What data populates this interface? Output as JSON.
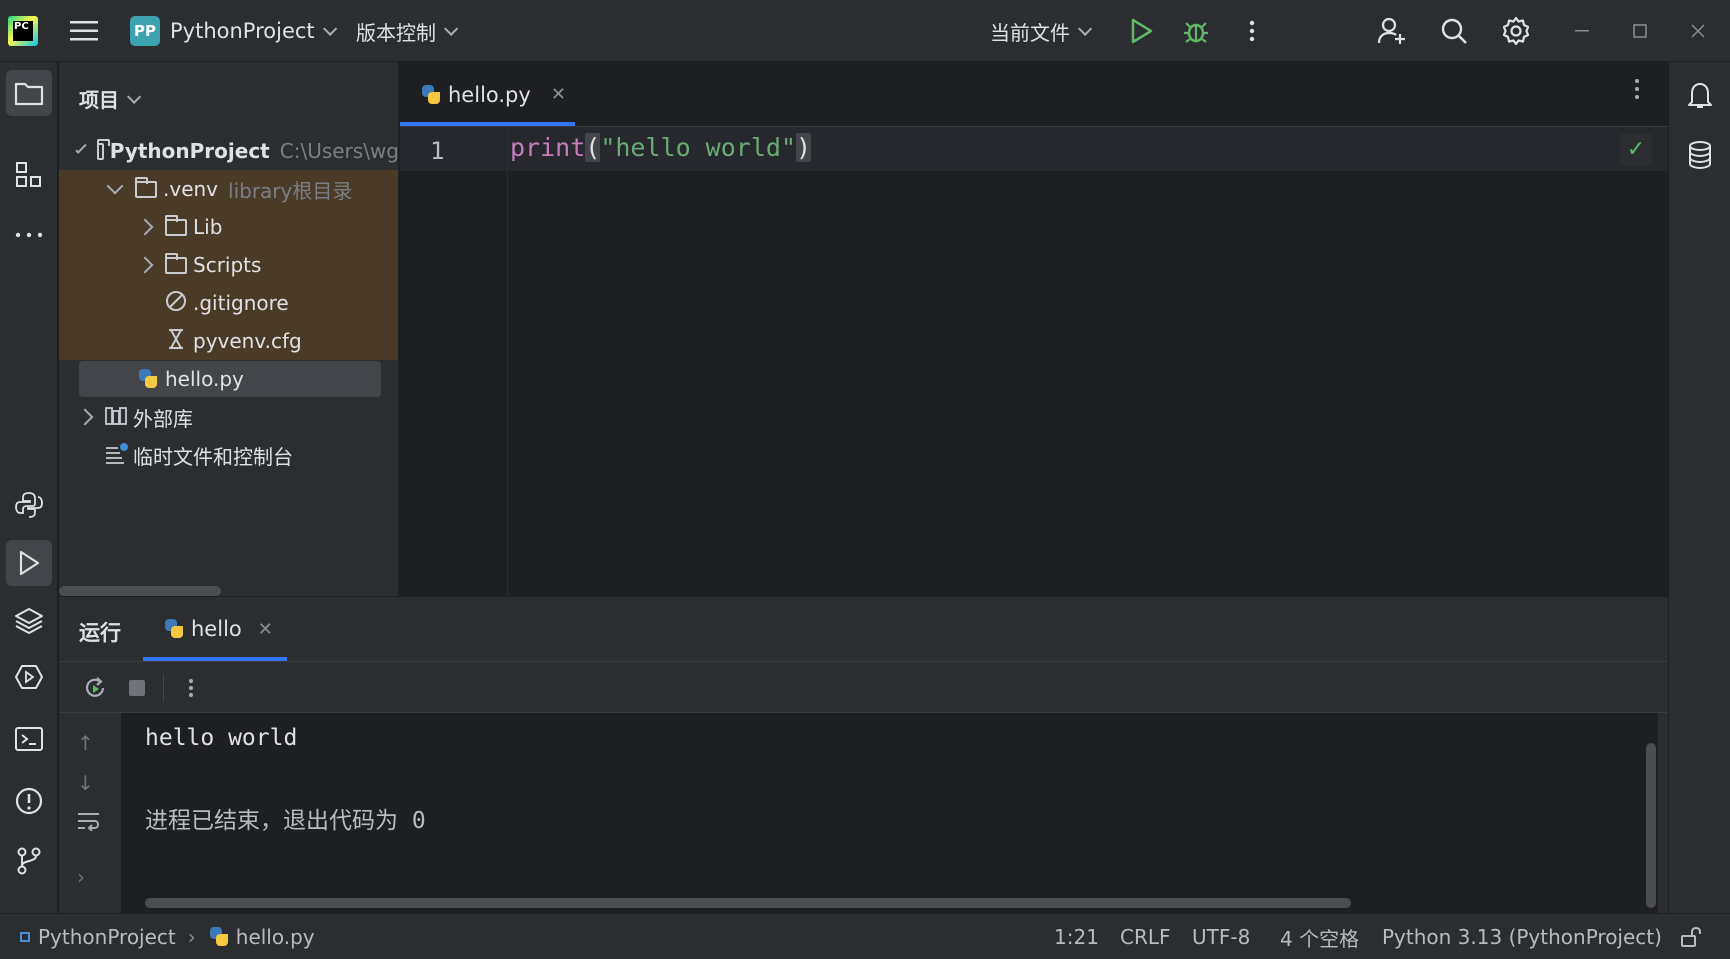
{
  "titlebar": {
    "project_badge": "PP",
    "project_name": "PythonProject",
    "vcs_label": "版本控制",
    "run_config": "当前文件",
    "icons": {
      "logo": "pycharm-logo-icon",
      "menu": "hamburger-menu-icon",
      "run": "run-icon",
      "debug": "debug-icon",
      "more": "more-vertical-icon",
      "collab": "add-user-icon",
      "search": "search-icon",
      "settings": "gear-icon",
      "minimize": "minimize-icon",
      "maximize": "maximize-icon",
      "close": "close-icon"
    }
  },
  "project_panel": {
    "title": "项目",
    "tree": [
      {
        "label": "PythonProject",
        "hint": "C:\\Users\\wg",
        "level": 0,
        "expanded": true,
        "kind": "folder"
      },
      {
        "label": ".venv",
        "hint": "library根目录",
        "level": 1,
        "expanded": true,
        "kind": "folder"
      },
      {
        "label": "Lib",
        "level": 2,
        "expanded": false,
        "kind": "folder"
      },
      {
        "label": "Scripts",
        "level": 2,
        "expanded": false,
        "kind": "folder"
      },
      {
        "label": ".gitignore",
        "level": 2,
        "kind": "ignore-file"
      },
      {
        "label": "pyvenv.cfg",
        "level": 2,
        "kind": "config-file"
      },
      {
        "label": "hello.py",
        "level": 1,
        "kind": "python-file",
        "selected": true
      },
      {
        "label": "外部库",
        "level": 0,
        "expanded": false,
        "kind": "library"
      },
      {
        "label": "临时文件和控制台",
        "level": 0,
        "kind": "scratches"
      }
    ]
  },
  "editor": {
    "tab_label": "hello.py",
    "line_number": "1",
    "code": {
      "fn": "print",
      "open": "(",
      "str": "\"hello world\"",
      "close": ")"
    },
    "inspection": "✓"
  },
  "run_panel": {
    "title": "运行",
    "tab_label": "hello",
    "output": [
      "hello world",
      "进程已结束，退出代码为 0"
    ]
  },
  "statusbar": {
    "breadcrumb_project": "PythonProject",
    "breadcrumb_file": "hello.py",
    "position": "1:21",
    "line_sep": "CRLF",
    "encoding": "UTF-8",
    "indent": "4 个空格",
    "interpreter": "Python 3.13 (PythonProject)"
  },
  "colors": {
    "accent": "#3574f0",
    "background": "#1e1f22",
    "panel": "#2b2d30",
    "excluded_bg": "#4a3a28",
    "run_green": "#5fb865",
    "string": "#6aab73",
    "function": "#c77dbb"
  }
}
